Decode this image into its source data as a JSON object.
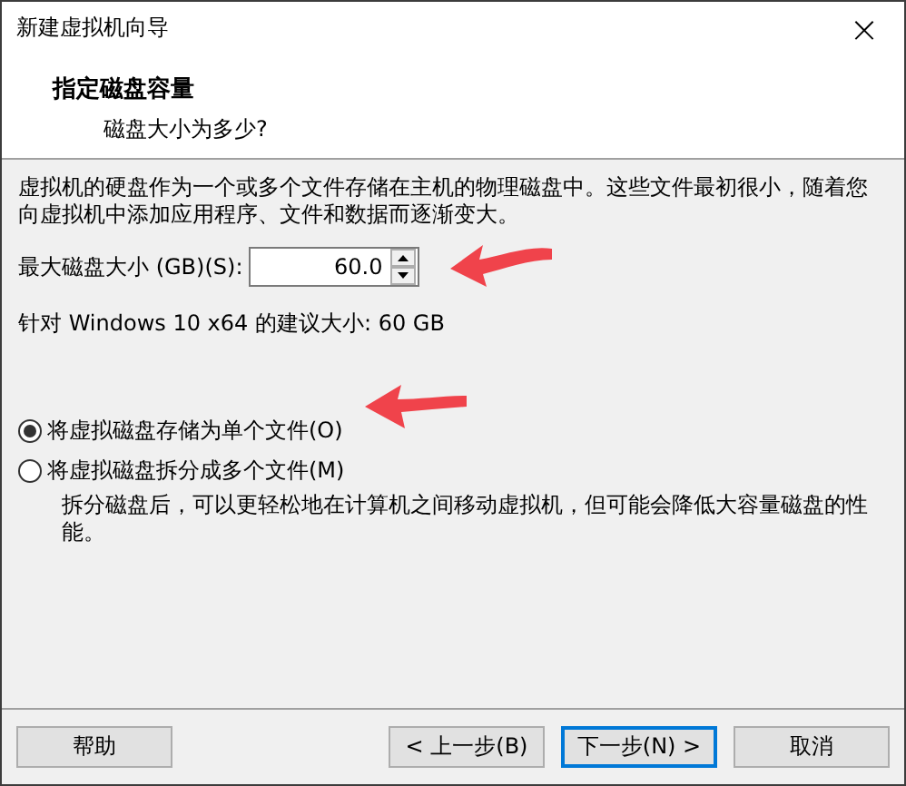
{
  "window": {
    "title": "新建虚拟机向导",
    "close_glyph": "×"
  },
  "header": {
    "title": "指定磁盘容量",
    "subtitle": "磁盘大小为多少?"
  },
  "intro": "虚拟机的硬盘作为一个或多个文件存储在主机的物理磁盘中。这些文件最初很小，随着您向虚拟机中添加应用程序、文件和数据而逐渐变大。",
  "disk_size": {
    "label": "最大磁盘大小 (GB)(S):",
    "value": "60.0"
  },
  "recommendation": "针对 Windows 10 x64 的建议大小: 60 GB",
  "storage_options": [
    {
      "label": "将虚拟磁盘存储为单个文件(O)",
      "selected": true
    },
    {
      "label": "将虚拟磁盘拆分成多个文件(M)",
      "selected": false,
      "note": "拆分磁盘后，可以更轻松地在计算机之间移动虚拟机，但可能会降低大容量磁盘的性能。"
    }
  ],
  "left_buttons": [
    {
      "label": "帮助",
      "focused": false
    }
  ],
  "right_buttons": [
    {
      "label": "< 上一步(B)",
      "focused": false
    },
    {
      "label": "下一步(N) >",
      "focused": true
    },
    {
      "label": "取消",
      "focused": false
    }
  ]
}
